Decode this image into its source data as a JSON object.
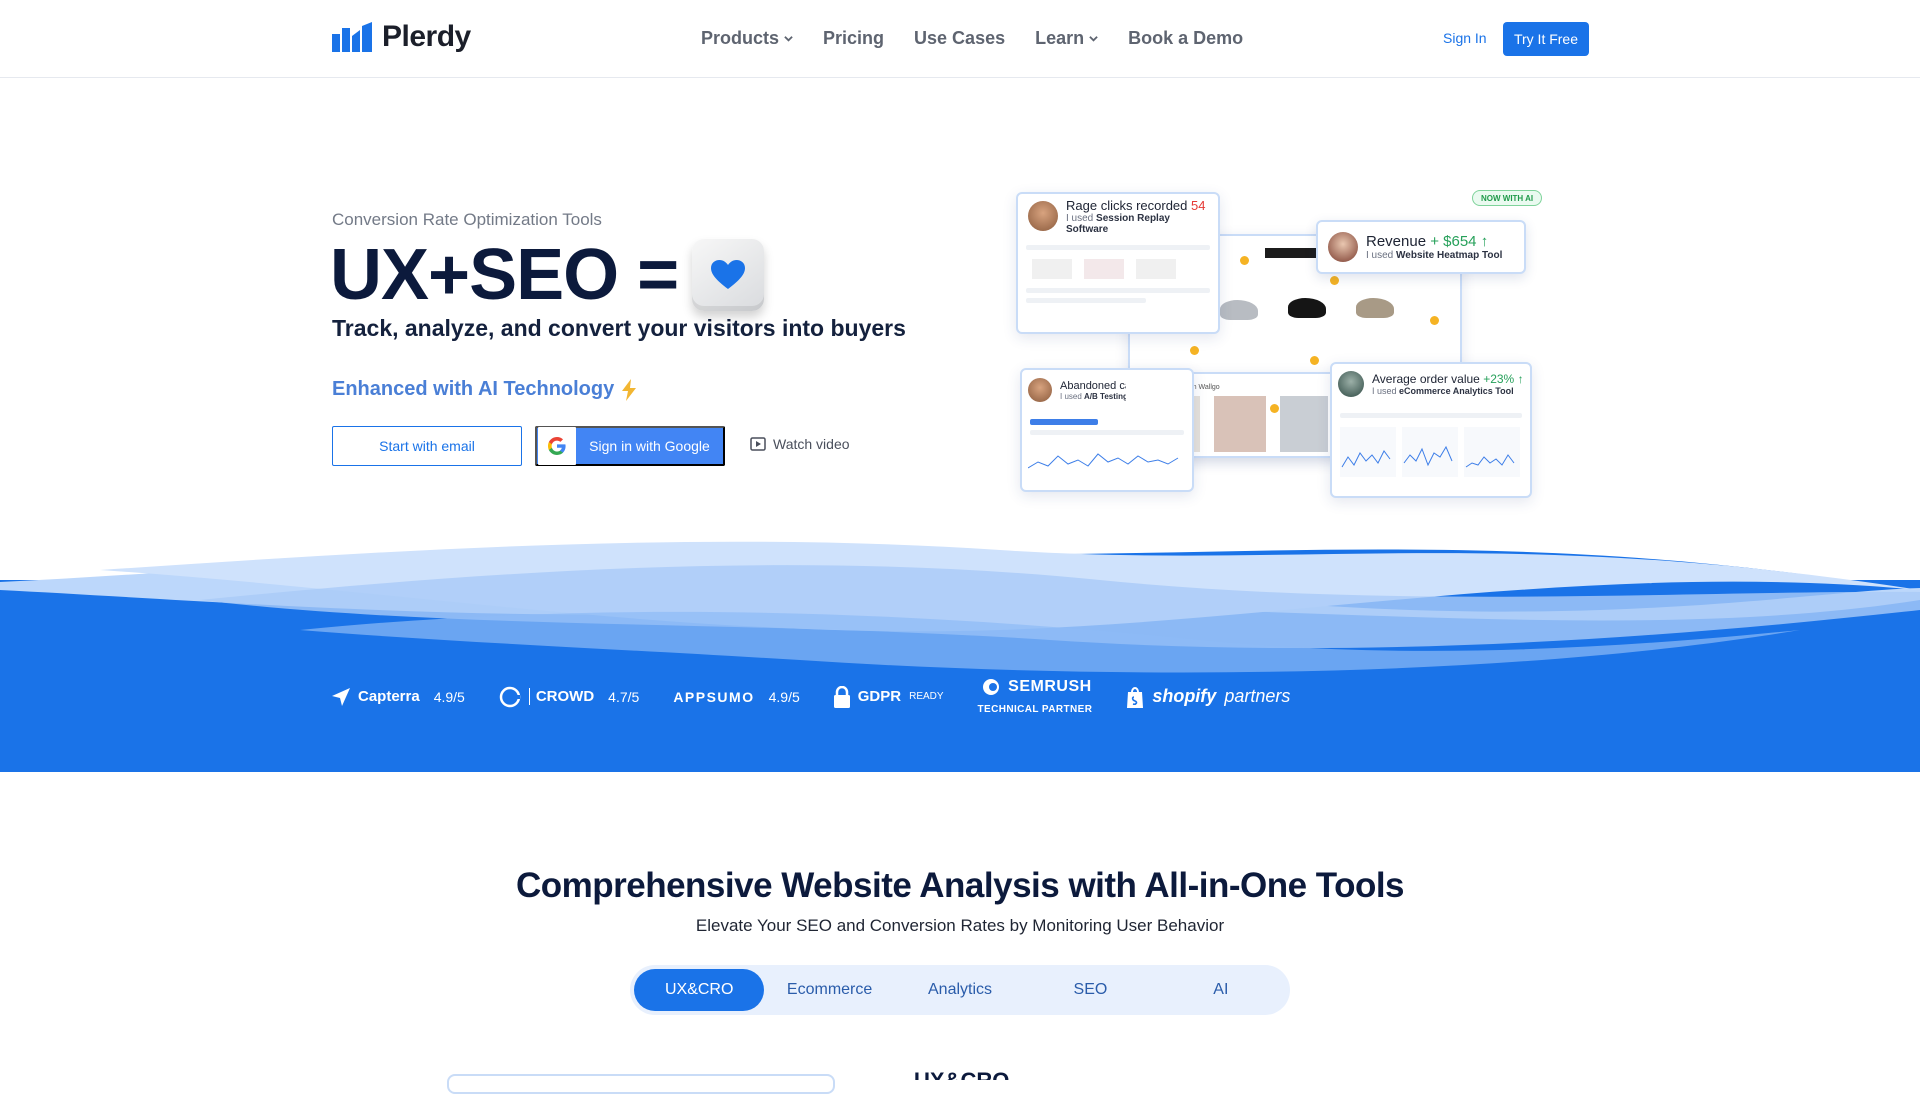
{
  "brand": {
    "name": "Plerdy",
    "primary_color": "#1a73e8",
    "dark_color": "#0c1a3c"
  },
  "nav": {
    "menu": [
      {
        "label": "Products",
        "has_dropdown": true
      },
      {
        "label": "Pricing",
        "has_dropdown": false
      },
      {
        "label": "Use Cases",
        "has_dropdown": false
      },
      {
        "label": "Learn",
        "has_dropdown": true
      },
      {
        "label": "Book a Demo",
        "has_dropdown": false
      }
    ],
    "sign_in": "Sign In",
    "try_free": "Try It Free"
  },
  "hero": {
    "kicker": "Conversion Rate Optimization Tools",
    "title": "UX+SEO =",
    "subtitle": "Track, analyze, and convert your visitors into buyers",
    "ai_line": "Enhanced with AI Technology",
    "ai_icon": "lightning-icon",
    "start_email": "Start with email",
    "google_signin": "Sign in with Google",
    "watch_video": "Watch video"
  },
  "collage": {
    "ai_badge": "NOW WITH AI",
    "rage": {
      "title": "Rage clicks recorded",
      "value": "54",
      "prefix": "I used",
      "tool": "Session Replay Software"
    },
    "revenue": {
      "title": "Revenue",
      "value": "+ $654",
      "prefix": "I used",
      "tool": "Website Heatmap Tool"
    },
    "abandoned": {
      "title": "Abandoned car",
      "prefix": "I used",
      "tool": "A/B Testing T"
    },
    "aov": {
      "title": "Average order value",
      "value": "+23%",
      "prefix": "I used",
      "tool": "eCommerce Analytics Tool"
    },
    "offers_caption": "Current offers from Wallgo"
  },
  "trust": {
    "capterra": {
      "name": "Capterra",
      "score": "4.9/5"
    },
    "g2": {
      "name": "CROWD",
      "score": "4.7/5"
    },
    "appsumo": {
      "name": "APPSUMO",
      "score": "4.9/5"
    },
    "gdpr": {
      "name": "GDPR",
      "tag": "READY"
    },
    "semrush": {
      "name": "SEMRUSH",
      "tag": "TECHNICAL PARTNER"
    },
    "shopify": {
      "name": "shopify",
      "tag": "partners"
    }
  },
  "section2": {
    "title": "Comprehensive Website Analysis with All-in-One Tools",
    "subtitle": "Elevate Your SEO and Conversion Rates by Monitoring User Behavior",
    "tabs": [
      "UX&CRO",
      "Ecommerce",
      "Analytics",
      "SEO",
      "AI"
    ],
    "active_tab": "UX&CRO",
    "peek_heading": "UX&CRO"
  }
}
